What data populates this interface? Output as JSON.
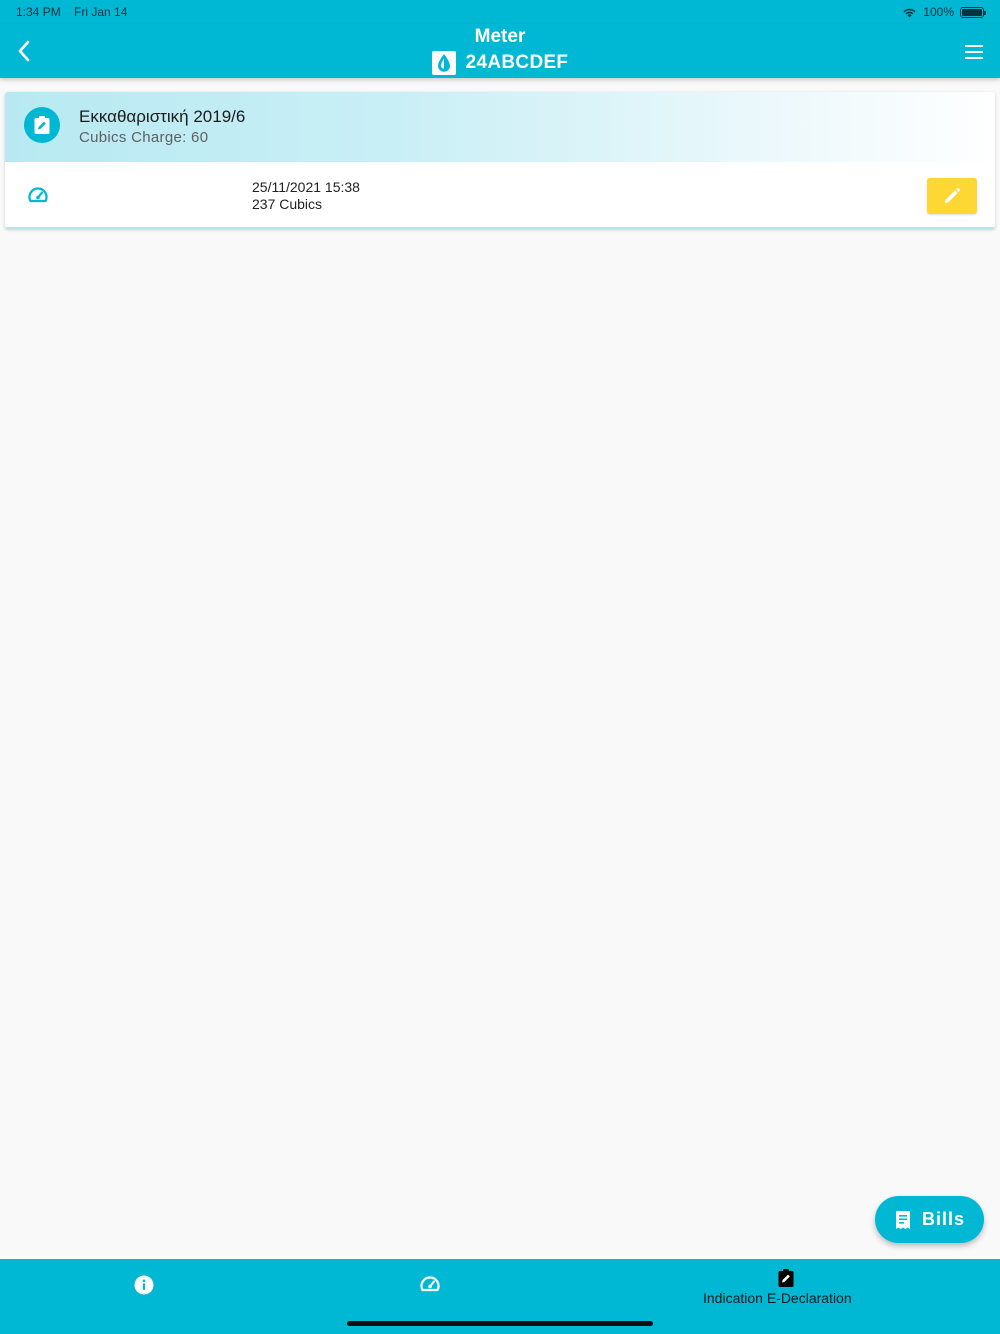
{
  "status_bar": {
    "time": "1:34 PM",
    "date": "Fri Jan 14",
    "battery": "100%"
  },
  "app_bar": {
    "title": "Meter",
    "meter_id": "24ABCDEF"
  },
  "card": {
    "title": "Εκκαθαριστική 2019/6",
    "subtitle": "Cubics Charge: 60",
    "reading": {
      "datetime": "25/11/2021 15:38",
      "value": "237 Cubics"
    }
  },
  "fab": {
    "label": "Bills"
  },
  "bottom_nav": {
    "tabs": [
      {
        "id": "info",
        "icon": "info-icon"
      },
      {
        "id": "gauge",
        "icon": "gauge-icon"
      },
      {
        "id": "declaration",
        "icon": "edit-document-icon",
        "label": "Indication E-Declaration"
      }
    ]
  },
  "colors": {
    "primary": "#00b7d4",
    "edit_button": "#fdd835",
    "background": "#f9f9f9"
  }
}
